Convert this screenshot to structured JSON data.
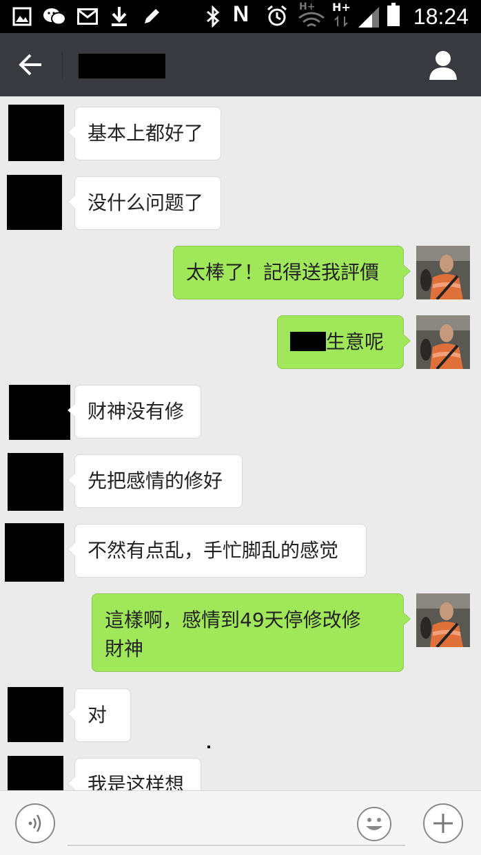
{
  "status_bar": {
    "time": "18:24",
    "icons": [
      "gallery-icon",
      "wechat-icon",
      "mail-icon",
      "download-icon",
      "edit-icon",
      "bluetooth-icon",
      "nfc-icon",
      "alarm-icon",
      "wifi-hplus-icon",
      "hplus-data-icon",
      "signal-icon",
      "battery-icon"
    ],
    "nfc_label": "N",
    "hplus_label_1": "H+",
    "hplus_label_2": "H+"
  },
  "header": {
    "back_icon": "back-arrow-icon",
    "profile_icon": "profile-icon"
  },
  "messages": [
    {
      "side": "left",
      "text": "基本上都好了"
    },
    {
      "side": "left",
      "text": "没什么问题了"
    },
    {
      "side": "right",
      "text": "太棒了！記得送我評價"
    },
    {
      "side": "right",
      "text_suffix": "生意呢"
    },
    {
      "side": "left",
      "text": "财神没有修"
    },
    {
      "side": "left",
      "text": "先把感情的修好"
    },
    {
      "side": "left",
      "text": "不然有点乱，手忙脚乱的感觉"
    },
    {
      "side": "right",
      "line1": "這樣啊，感情到49天停修改修",
      "line2": "財神"
    },
    {
      "side": "left",
      "text": "对"
    },
    {
      "side": "left",
      "text": "我是这样想"
    }
  ],
  "input_bar": {
    "voice_icon": "voice-icon",
    "emoji_icon": "emoji-icon",
    "plus_icon": "plus-icon"
  },
  "colors": {
    "outgoing_bubble": "#a0e75a",
    "incoming_bubble": "#ffffff",
    "header_bg": "#393a3f",
    "chat_bg": "#ebebeb"
  }
}
